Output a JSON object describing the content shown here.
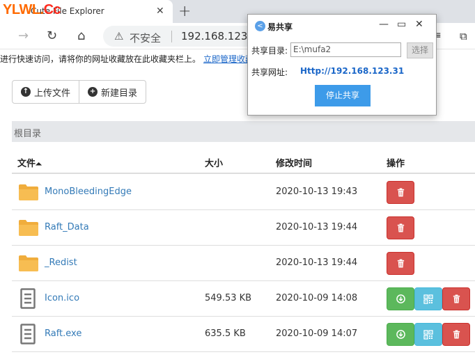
{
  "browser": {
    "watermark_part1": "YLWL.",
    "watermark_part2": "Cc",
    "tab_title": "Cute File Explorer",
    "tab_close": "✕",
    "new_tab": "+",
    "insecure_label": "不安全",
    "url": "192.168.123.31",
    "infobar_text": "进行快速访问，请将你的网址收藏放在此收藏夹栏上。",
    "infobar_link": "立即管理收藏"
  },
  "toolbar": {
    "upload_label": "上传文件",
    "new_dir_label": "新建目录"
  },
  "breadcrumb": "根目录",
  "table": {
    "headers": {
      "name": "文件",
      "sort_indicator": "⏶",
      "size": "大小",
      "mtime": "修改时间",
      "actions": "操作"
    },
    "rows": [
      {
        "type": "folder",
        "name": "MonoBleedingEdge",
        "size": "",
        "mtime": "2020-10-13 19:43"
      },
      {
        "type": "folder",
        "name": "Raft_Data",
        "size": "",
        "mtime": "2020-10-13 19:44"
      },
      {
        "type": "folder",
        "name": "_Redist",
        "size": "",
        "mtime": "2020-10-13 19:44"
      },
      {
        "type": "file",
        "name": "Icon.ico",
        "size": "549.53 KB",
        "mtime": "2020-10-09 14:08"
      },
      {
        "type": "file",
        "name": "Raft.exe",
        "size": "635.5 KB",
        "mtime": "2020-10-09 14:07"
      }
    ]
  },
  "popup": {
    "title": "易共享",
    "dir_label": "共享目录:",
    "dir_value": "E:\\mufa2",
    "choose_label": "选择",
    "url_label": "共享网址:",
    "url_value": "Http://192.168.123.31",
    "stop_label": "停止共享"
  },
  "colors": {
    "delete": "#d9534f",
    "download": "#5cb85c",
    "qrcode": "#5bc0de",
    "link": "#337ab7",
    "folder": "#f0ad3c",
    "primary": "#3d9be9"
  }
}
